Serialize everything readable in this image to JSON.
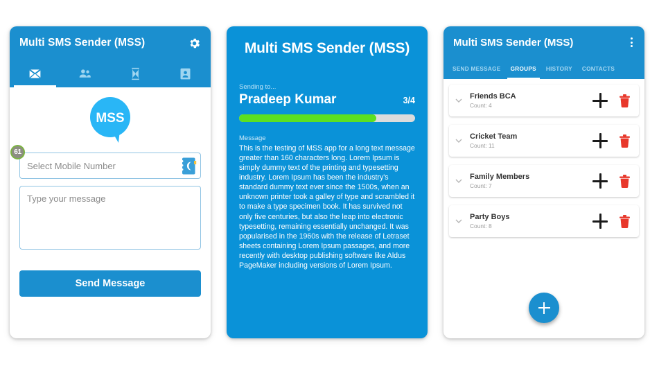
{
  "colors": {
    "appbar_blue": "#1b8fcf",
    "panel2_blue": "#0a92d8",
    "progress_green": "#5ce021",
    "trash_red": "#e8382b",
    "logo_blue": "#29b6f6"
  },
  "panel1": {
    "title": "Multi SMS Sender (MSS)",
    "settings_icon": "gear-icon",
    "tabs": [
      {
        "icon": "message-envelope-icon",
        "active": true
      },
      {
        "icon": "group-people-icon",
        "active": false
      },
      {
        "icon": "hourglass-history-icon",
        "active": false
      },
      {
        "icon": "contact-card-icon",
        "active": false
      }
    ],
    "logo_text": "MSS",
    "badge_count": "61",
    "phone_placeholder": "Select Mobile Number",
    "phone_value": "",
    "contact_picker_icon": "address-book-icon",
    "message_placeholder": "Type your message",
    "message_value": "",
    "send_label": "Send Message"
  },
  "panel2": {
    "title": "Multi SMS Sender (MSS)",
    "sending_label": "Sending to...",
    "recipient": "Pradeep Kumar",
    "counter": "3/4",
    "progress_percent": 78,
    "message_label": "Message",
    "message_body": "This is the testing of MSS app for a long text message greater than 160 characters long. Lorem Ipsum is simply dummy text of the printing and typesetting industry. Lorem Ipsum has been the industry's standard dummy text ever since the 1500s, when an unknown printer took a galley of type and scrambled it to make a type specimen book. It has survived not only five centuries, but also the leap into electronic typesetting, remaining essentially unchanged. It was popularised in the 1960s with the release of Letraset sheets containing Lorem Ipsum passages, and more recently with desktop publishing software like Aldus PageMaker including versions of Lorem Ipsum."
  },
  "panel3": {
    "title": "Multi SMS Sender (MSS)",
    "overflow_icon": "kebab-menu-icon",
    "tabs": [
      {
        "label": "SEND MESSAGE",
        "active": false
      },
      {
        "label": "GROUPS",
        "active": true
      },
      {
        "label": "HISTORY",
        "active": false
      },
      {
        "label": "CONTACTS",
        "active": false
      }
    ],
    "groups": [
      {
        "name": "Friends BCA",
        "count": "Count: 4"
      },
      {
        "name": "Cricket Team",
        "count": "Count: 11"
      },
      {
        "name": "Family Members",
        "count": "Count: 7"
      },
      {
        "name": "Party Boys",
        "count": "Count: 8"
      }
    ],
    "fab_icon": "plus-icon"
  }
}
